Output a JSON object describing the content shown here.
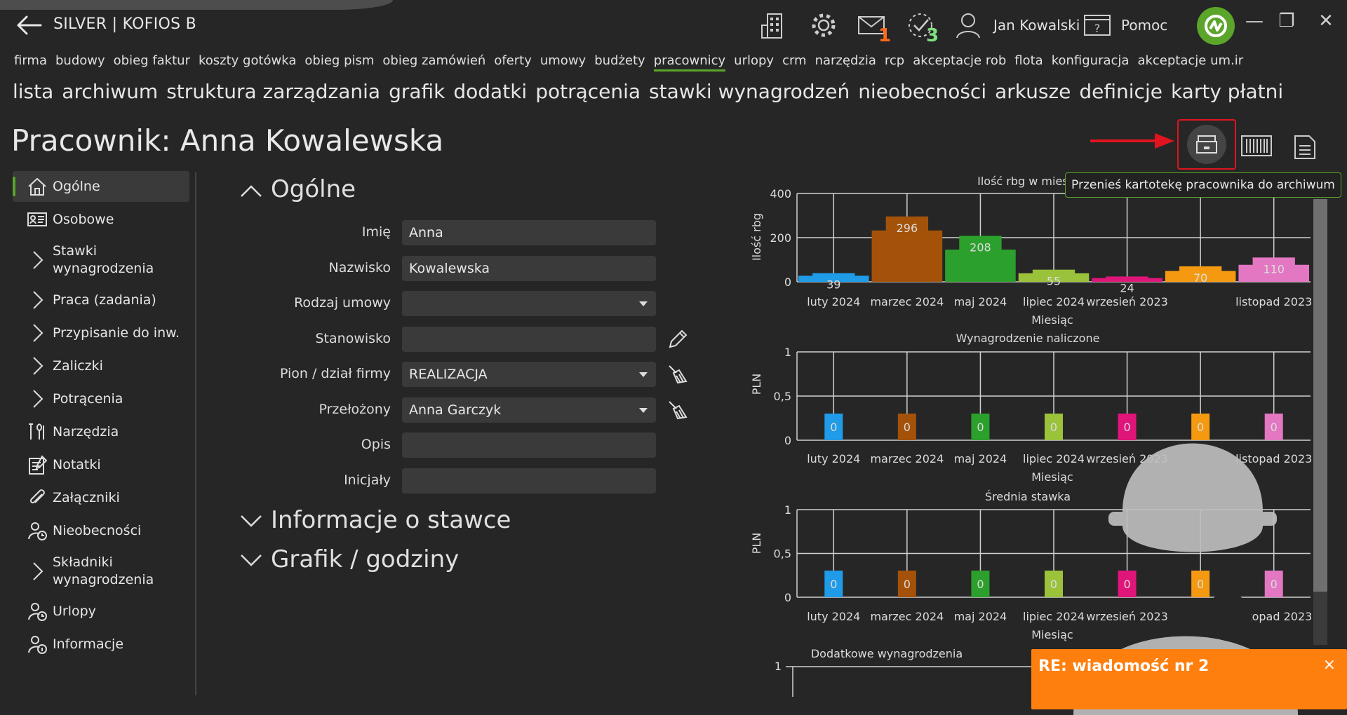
{
  "app": {
    "title": "SILVER | KOFIOS B",
    "user": "Jan Kowalski",
    "help": "Pomoc"
  },
  "badges": {
    "mail": "1",
    "tasks": "3"
  },
  "colors": {
    "accent": "#5aa52a",
    "mail_badge": "#ff6a1a",
    "tasks_badge": "#7ee27e",
    "toast": "#ff7f0e"
  },
  "menu1": [
    "firma",
    "budowy",
    "obieg faktur",
    "koszty gotówka",
    "obieg pism",
    "obieg zamówień",
    "oferty",
    "umowy",
    "budżety",
    "pracownicy",
    "urlopy",
    "crm",
    "narzędzia",
    "rcp",
    "akceptacje rob",
    "flota",
    "konfiguracja",
    "akceptacje um.ir"
  ],
  "menu1_active": "pracownicy",
  "menu2": [
    "lista",
    "archiwum",
    "struktura zarządzania",
    "grafik",
    "dodatki",
    "potrącenia",
    "stawki wynagrodzeń",
    "nieobecności",
    "arkusze",
    "definicje",
    "karty płatni"
  ],
  "page": {
    "title": "Pracownik: Anna Kowalewska"
  },
  "sidebar": [
    {
      "label": "Ogólne",
      "icon": "home-icon",
      "active": true
    },
    {
      "label": "Osobowe",
      "icon": "id-card-icon"
    },
    {
      "label": "Stawki\nwynagrodzenia",
      "icon": "chevron-right-icon",
      "tall": true
    },
    {
      "label": "Praca (zadania)",
      "icon": "chevron-right-icon"
    },
    {
      "label": "Przypisanie do inw.",
      "icon": "chevron-right-icon"
    },
    {
      "label": "Zaliczki",
      "icon": "chevron-right-icon"
    },
    {
      "label": "Potrącenia",
      "icon": "chevron-right-icon"
    },
    {
      "label": "Narzędzia",
      "icon": "tools-icon"
    },
    {
      "label": "Notatki",
      "icon": "notes-icon"
    },
    {
      "label": "Załączniki",
      "icon": "paperclip-icon"
    },
    {
      "label": "Nieobecności",
      "icon": "person-clock-icon"
    },
    {
      "label": "Składniki\nwynagrodzenia",
      "icon": "chevron-right-icon",
      "tall": true
    },
    {
      "label": "Urlopy",
      "icon": "person-clock-icon"
    },
    {
      "label": "Informacje",
      "icon": "person-info-icon"
    }
  ],
  "form": {
    "section": "Ogólne",
    "fields": [
      {
        "label": "Imię",
        "value": "Anna",
        "dropdown": false
      },
      {
        "label": "Nazwisko",
        "value": "Kowalewska",
        "dropdown": false
      },
      {
        "label": "Rodzaj umowy",
        "value": "",
        "dropdown": true
      },
      {
        "label": "Stanowisko",
        "value": "",
        "dropdown": false,
        "action": "pencil-icon"
      },
      {
        "label": "Pion / dział firmy",
        "value": "REALIZACJA",
        "dropdown": true,
        "action": "broom-icon"
      },
      {
        "label": "Przełożony",
        "value": "Anna Garczyk",
        "dropdown": true,
        "action": "broom-icon"
      },
      {
        "label": "Opis",
        "value": "",
        "dropdown": false
      },
      {
        "label": "Inicjały",
        "value": "",
        "dropdown": false
      }
    ],
    "collapsed_sections": [
      "Informacje o stawce",
      "Grafik / godziny"
    ]
  },
  "tooltip": "Przenieś kartotekę pracownika do archiwum",
  "toast": {
    "title": "RE: wiadomość nr 2",
    "close": "×"
  },
  "chart_data": [
    {
      "type": "bar",
      "title": "Ilość rbg w miesią",
      "xlabel": "Miesiąc",
      "ylabel": "Ilość rbg",
      "ylim": [
        0,
        400
      ],
      "yticks": [
        "0",
        "200",
        "400"
      ],
      "categories": [
        "luty 2024",
        "marzec 2024",
        "maj 2024",
        "lipiec 2024",
        "wrzesień 2023",
        "listopad 2023"
      ],
      "category_labels_shown": [
        "luty 2024",
        "marzec 2024",
        "maj 2024",
        "lipiec 2024",
        "wrzesień 2023",
        "",
        "listopad 2023"
      ],
      "bars": [
        {
          "value": 39,
          "label": "39",
          "color": "#1f9be8"
        },
        {
          "value": 296,
          "label": "296",
          "color": "#a4520a"
        },
        {
          "value": 208,
          "label": "208",
          "color": "#2ca02c"
        },
        {
          "value": 55,
          "label": "55",
          "color": "#9ac23a"
        },
        {
          "value": 24,
          "label": "24",
          "color": "#e0157a"
        },
        {
          "value": 70,
          "label": "70",
          "color": "#f59a10"
        },
        {
          "value": 110,
          "label": "110",
          "color": "#e377c2"
        }
      ],
      "grid": true
    },
    {
      "type": "bar",
      "title": "Wynagrodzenie naliczone",
      "xlabel": "Miesiąc",
      "ylabel": "PLN",
      "ylim": [
        0,
        1
      ],
      "yticks": [
        "0",
        "0,5",
        "1"
      ],
      "category_labels_shown": [
        "luty 2024",
        "marzec 2024",
        "maj 2024",
        "lipiec 2024",
        "wrzesień 2023",
        "",
        "listopad 2023"
      ],
      "bars": [
        {
          "value": 0,
          "label": "0",
          "color": "#1f9be8"
        },
        {
          "value": 0,
          "label": "0",
          "color": "#a4520a"
        },
        {
          "value": 0,
          "label": "0",
          "color": "#2ca02c"
        },
        {
          "value": 0,
          "label": "0",
          "color": "#9ac23a"
        },
        {
          "value": 0,
          "label": "0",
          "color": "#e0157a"
        },
        {
          "value": 0,
          "label": "0",
          "color": "#f59a10"
        },
        {
          "value": 0,
          "label": "0",
          "color": "#e377c2"
        }
      ],
      "grid": true
    },
    {
      "type": "bar",
      "title": "Średnia stawka",
      "xlabel": "Miesiąc",
      "ylabel": "PLN",
      "ylim": [
        0,
        1
      ],
      "yticks": [
        "0",
        "0,5",
        "1"
      ],
      "category_labels_shown": [
        "luty 2024",
        "marzec 2024",
        "maj 2024",
        "lipiec 2024",
        "wrzesień 2023",
        "",
        "listopad 2023"
      ],
      "bars": [
        {
          "value": 0,
          "label": "0",
          "color": "#1f9be8"
        },
        {
          "value": 0,
          "label": "0",
          "color": "#a4520a"
        },
        {
          "value": 0,
          "label": "0",
          "color": "#2ca02c"
        },
        {
          "value": 0,
          "label": "0",
          "color": "#9ac23a"
        },
        {
          "value": 0,
          "label": "0",
          "color": "#e0157a"
        },
        {
          "value": 0,
          "label": "0",
          "color": "#f59a10"
        },
        {
          "value": 0,
          "label": "0",
          "color": "#e377c2"
        }
      ],
      "grid": true
    },
    {
      "type": "bar",
      "title": "Dodatkowe wynagrodzenia",
      "yticks": [
        "1"
      ]
    }
  ]
}
